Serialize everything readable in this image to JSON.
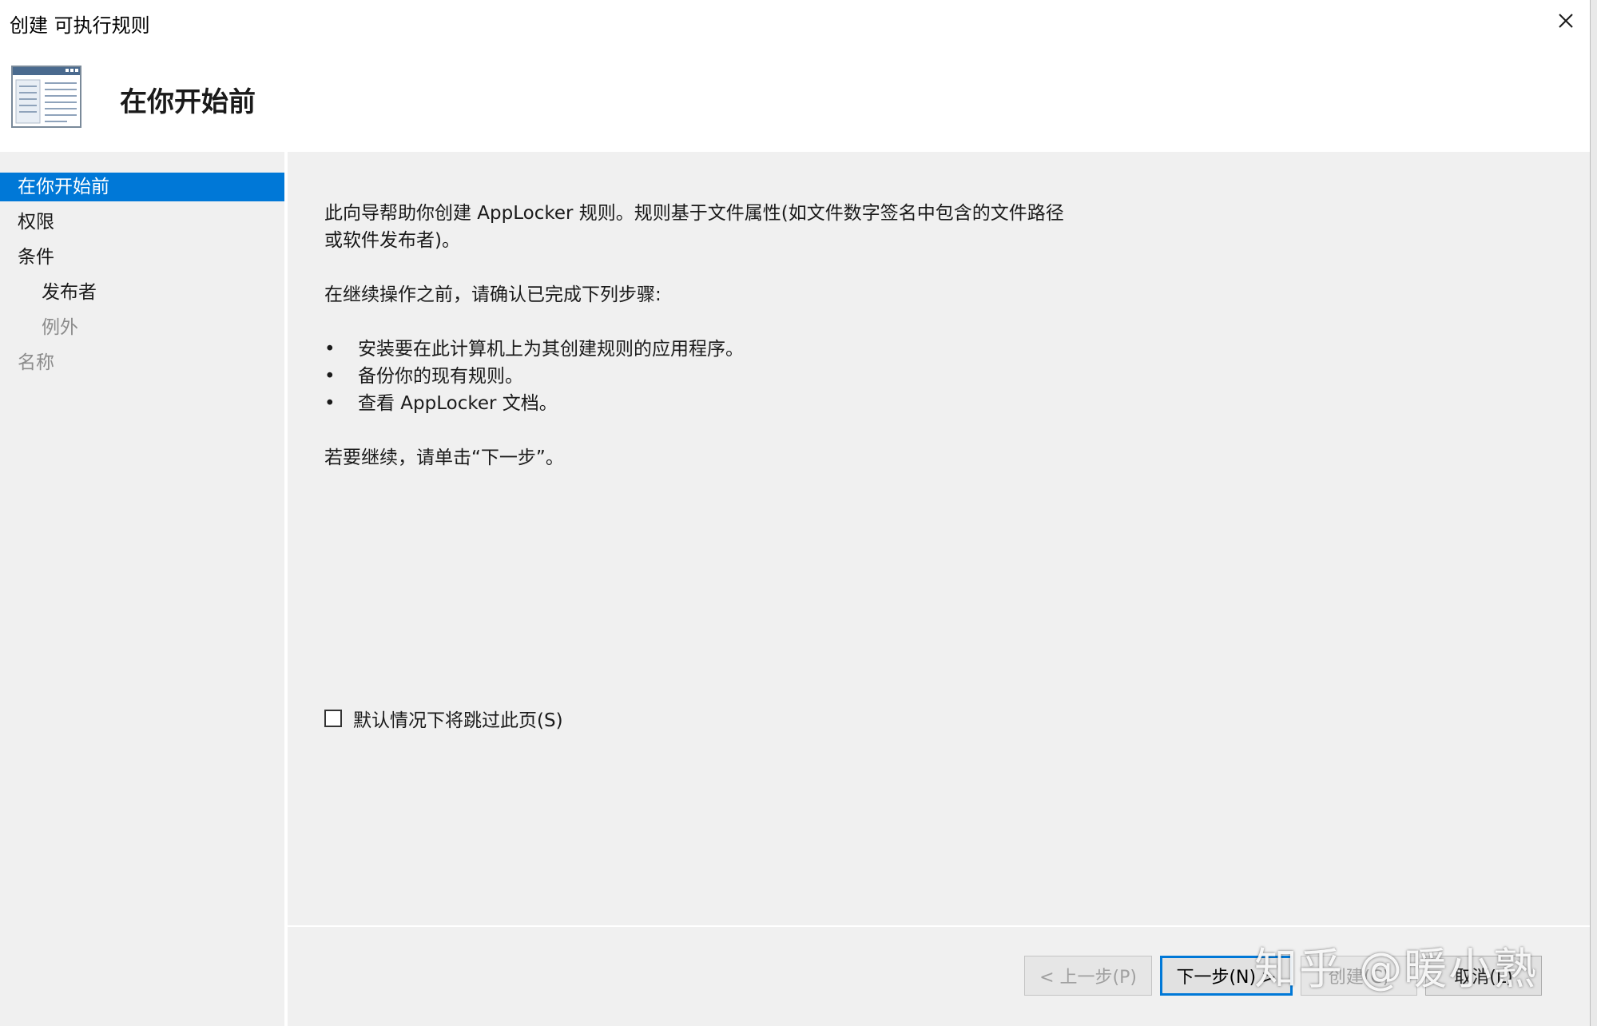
{
  "window": {
    "title": "创建 可执行规则"
  },
  "header": {
    "heading": "在你开始前",
    "icon": "wizard-window-icon"
  },
  "sidebar": {
    "items": [
      {
        "label": "在你开始前",
        "state": "active"
      },
      {
        "label": "权限",
        "state": "normal"
      },
      {
        "label": "条件",
        "state": "normal"
      },
      {
        "label": "发布者",
        "state": "normal"
      },
      {
        "label": "例外",
        "state": "disabled"
      },
      {
        "label": "名称",
        "state": "disabled"
      }
    ]
  },
  "main": {
    "intro_line1": "此向导帮助你创建 AppLocker 规则。规则基于文件属性(如文件数字签名中包含的文件路径",
    "intro_line2": "或软件发布者)。",
    "prereq_heading": "在继续操作之前，请确认已完成下列步骤:",
    "bullet_glyph": "•",
    "steps": [
      "安装要在此计算机上为其创建规则的应用程序。",
      "备份你的现有规则。",
      "查看 AppLocker 文档。"
    ],
    "continue_text": "若要继续，请单击“下一步”。",
    "skip_checkbox": {
      "label": "默认情况下将跳过此页(S)",
      "checked": false
    }
  },
  "footer": {
    "back_label": "< 上一步(P)",
    "next_label": "下一步(N) >",
    "create_label": "创建(C)",
    "cancel_label": "取消(L)"
  },
  "watermark": {
    "text": "知乎 @暖小熟"
  },
  "colors": {
    "accent": "#0078d7",
    "panel_bg": "#f0f0f0",
    "disabled_text": "#8c8c8c"
  }
}
